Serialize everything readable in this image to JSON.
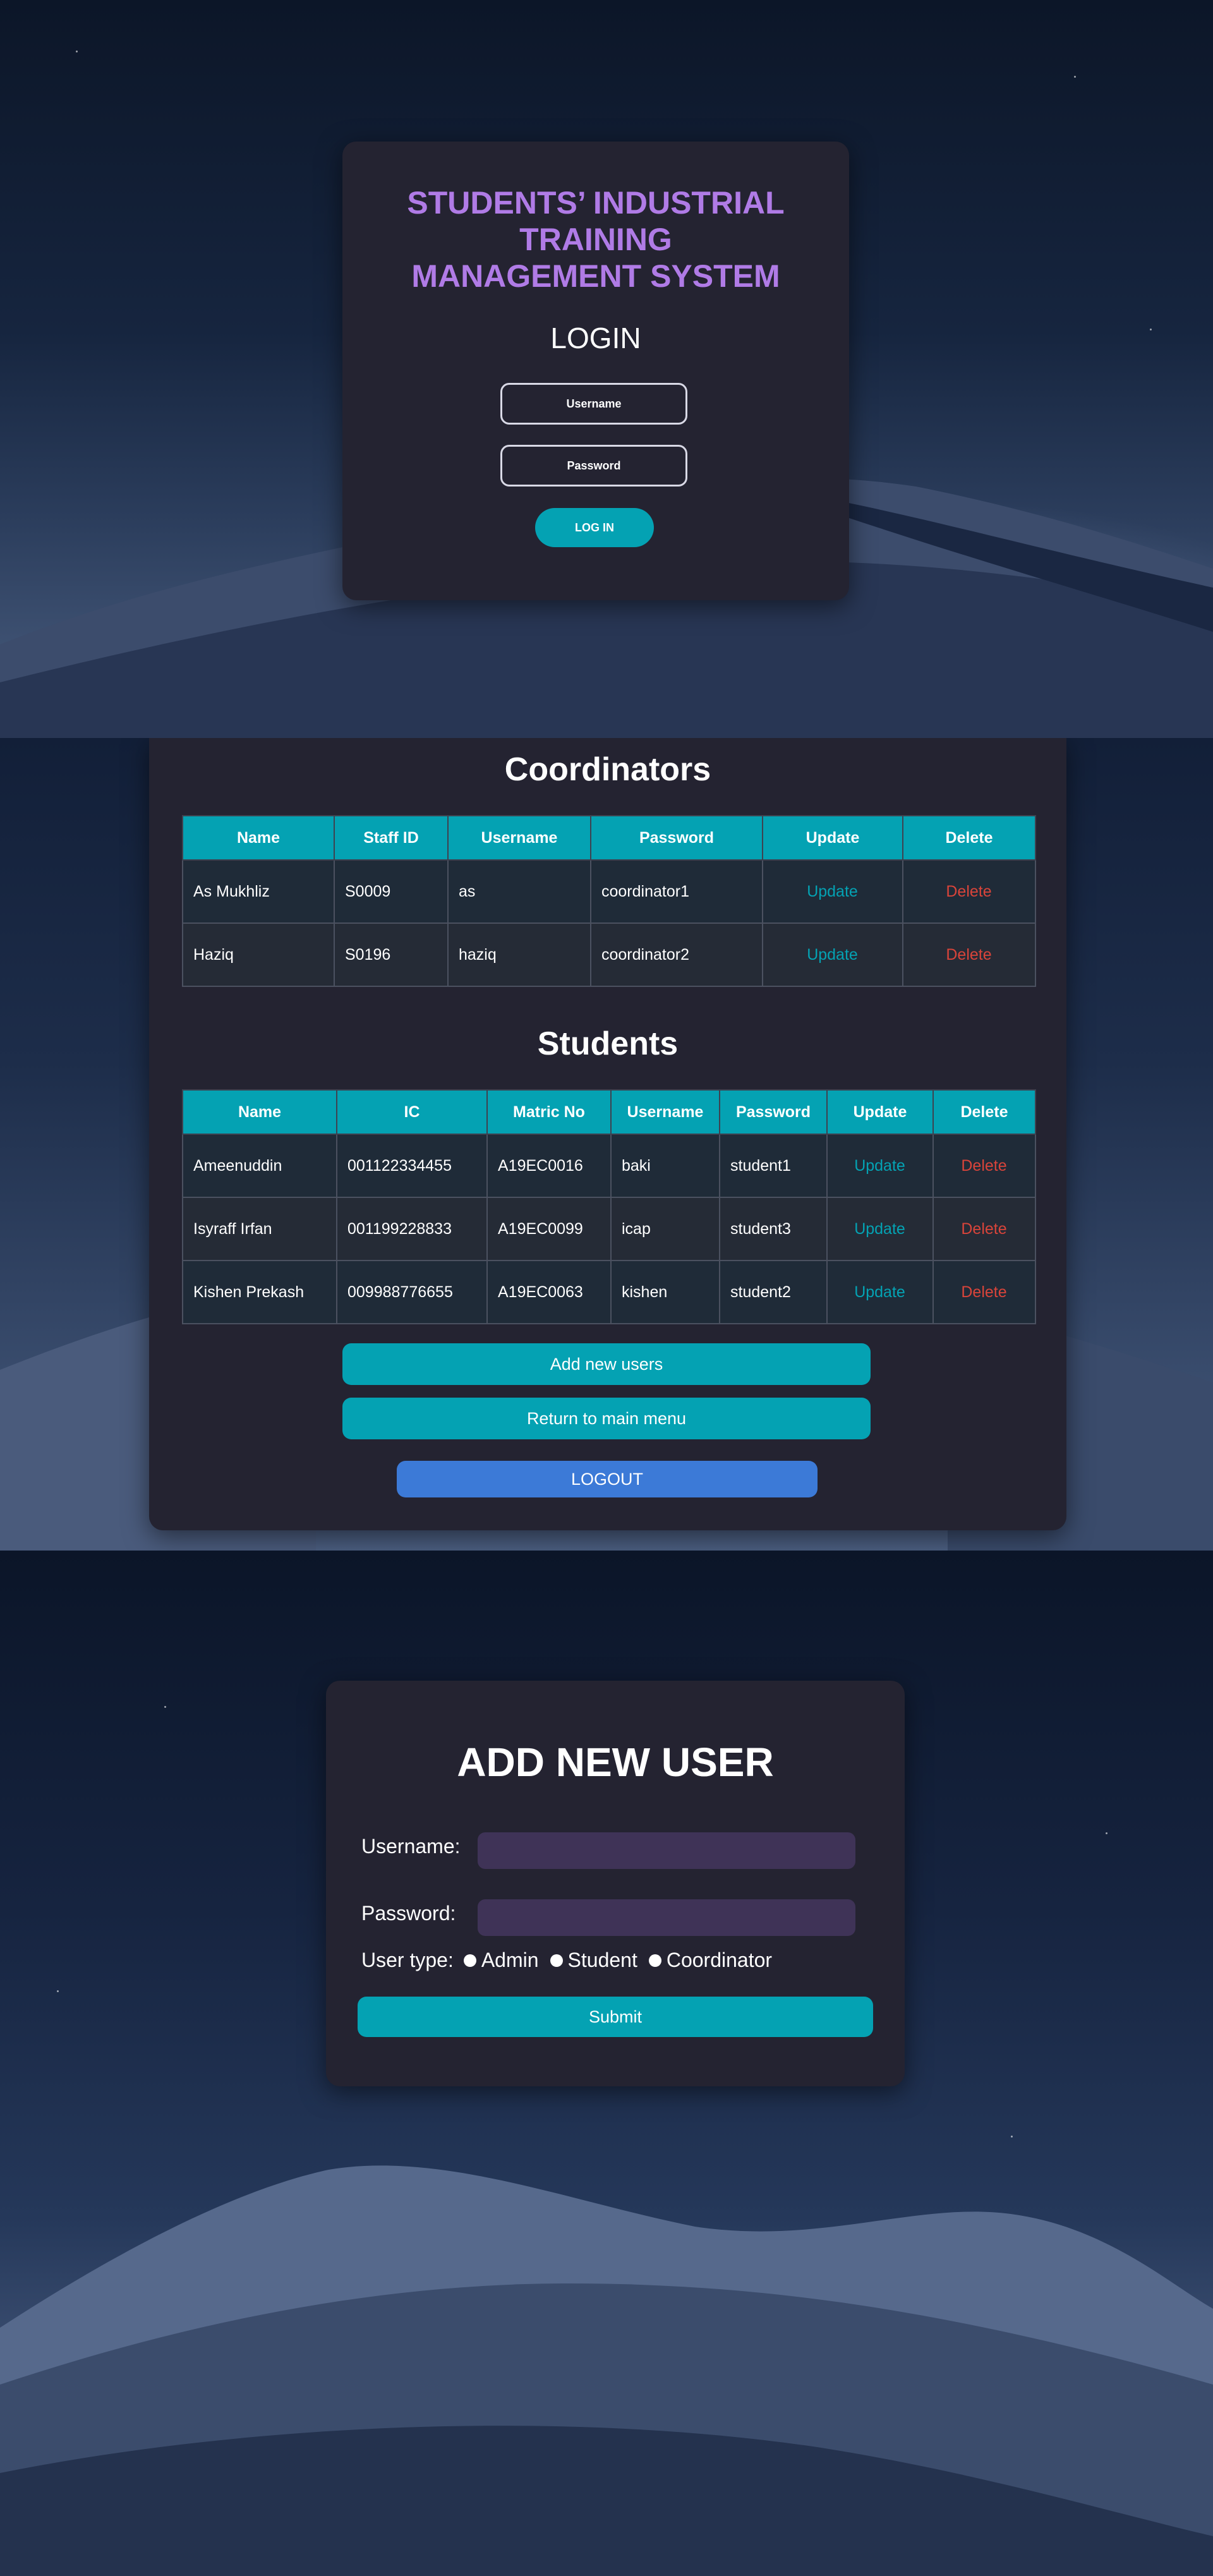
{
  "login": {
    "title": "STUDENTS’ INDUSTRIAL TRAINING MANAGEMENT SYSTEM",
    "subtitle": "LOGIN",
    "username_placeholder": "Username",
    "password_placeholder": "Password",
    "login_button": "LOG IN"
  },
  "coordinators": {
    "heading": "Coordinators",
    "columns": [
      "Name",
      "Staff ID",
      "Username",
      "Password",
      "Update",
      "Delete"
    ],
    "rows": [
      {
        "name": "As Mukhliz",
        "staff_id": "S0009",
        "username": "as",
        "password": "coordinator1",
        "update": "Update",
        "delete": "Delete"
      },
      {
        "name": "Haziq",
        "staff_id": "S0196",
        "username": "haziq",
        "password": "coordinator2",
        "update": "Update",
        "delete": "Delete"
      }
    ]
  },
  "students": {
    "heading": "Students",
    "columns": [
      "Name",
      "IC",
      "Matric No",
      "Username",
      "Password",
      "Update",
      "Delete"
    ],
    "rows": [
      {
        "name": "Ameenuddin",
        "ic": "001122334455",
        "matric": "A19EC0016",
        "username": "baki",
        "password": "student1",
        "update": "Update",
        "delete": "Delete"
      },
      {
        "name": "Isyraff Irfan",
        "ic": "001199228833",
        "matric": "A19EC0099",
        "username": "icap",
        "password": "student3",
        "update": "Update",
        "delete": "Delete"
      },
      {
        "name": "Kishen Prekash",
        "ic": "009988776655",
        "matric": "A19EC0063",
        "username": "kishen",
        "password": "student2",
        "update": "Update",
        "delete": "Delete"
      }
    ]
  },
  "actions": {
    "add_users": "Add new users",
    "return_main": "Return to main menu",
    "logout": "LOGOUT"
  },
  "add_user": {
    "title": "ADD NEW USER",
    "username_label": "Username:",
    "password_label": "Password:",
    "user_type_label": "User type:",
    "types": [
      "Admin",
      "Student",
      "Coordinator"
    ],
    "submit": "Submit"
  },
  "colors": {
    "accent": "#04a2b3",
    "title_purple": "#b07be6",
    "card": "#242331",
    "delete_red": "#d9443a",
    "logout_blue": "#3c7ad7",
    "input_fill": "#3f3357"
  }
}
